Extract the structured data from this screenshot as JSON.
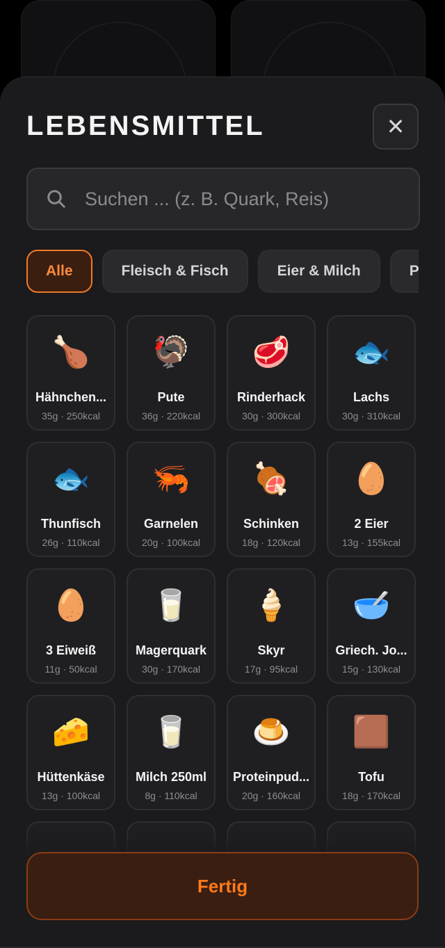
{
  "header": {
    "title": "LEBENSMITTEL",
    "close_icon": "close-icon"
  },
  "search": {
    "placeholder": "Suchen ... (z. B. Quark, Reis)",
    "value": ""
  },
  "categories": [
    {
      "label": "Alle",
      "active": true
    },
    {
      "label": "Fleisch & Fisch",
      "active": false
    },
    {
      "label": "Eier & Milch",
      "active": false
    },
    {
      "label": "Pf",
      "active": false
    }
  ],
  "foods": [
    {
      "icon": "🍗",
      "name": "Hähnchen...",
      "meta": "35g · 250kcal"
    },
    {
      "icon": "🦃",
      "name": "Pute",
      "meta": "36g · 220kcal"
    },
    {
      "icon": "🥩",
      "name": "Rinderhack",
      "meta": "30g · 300kcal"
    },
    {
      "icon": "🐟",
      "name": "Lachs",
      "meta": "30g · 310kcal"
    },
    {
      "icon": "🐟",
      "name": "Thunfisch",
      "meta": "26g · 110kcal"
    },
    {
      "icon": "🦐",
      "name": "Garnelen",
      "meta": "20g · 100kcal"
    },
    {
      "icon": "🍖",
      "name": "Schinken",
      "meta": "18g · 120kcal"
    },
    {
      "icon": "🥚",
      "name": "2 Eier",
      "meta": "13g · 155kcal"
    },
    {
      "icon": "🥚",
      "name": "3 Eiweiß",
      "meta": "11g · 50kcal"
    },
    {
      "icon": "🥛",
      "name": "Magerquark",
      "meta": "30g · 170kcal"
    },
    {
      "icon": "🍦",
      "name": "Skyr",
      "meta": "17g · 95kcal"
    },
    {
      "icon": "🥣",
      "name": "Griech. Jo...",
      "meta": "15g · 130kcal"
    },
    {
      "icon": "🧀",
      "name": "Hüttenkäse",
      "meta": "13g · 100kcal"
    },
    {
      "icon": "🥛",
      "name": "Milch 250ml",
      "meta": "8g · 110kcal"
    },
    {
      "icon": "🍮",
      "name": "Proteinpud...",
      "meta": "20g · 160kcal"
    },
    {
      "icon": "🟫",
      "name": "Tofu",
      "meta": "18g · 170kcal"
    },
    {
      "icon": "",
      "name": "",
      "meta": ""
    },
    {
      "icon": "",
      "name": "",
      "meta": ""
    },
    {
      "icon": "",
      "name": "",
      "meta": ""
    },
    {
      "icon": "",
      "name": "",
      "meta": ""
    }
  ],
  "footer": {
    "done_label": "Fertig"
  }
}
